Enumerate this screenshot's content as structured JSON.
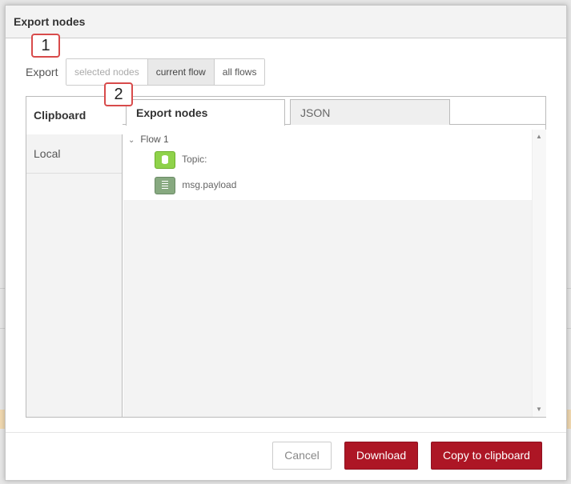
{
  "dialog": {
    "title": "Export nodes"
  },
  "export": {
    "label": "Export",
    "options": [
      "selected nodes",
      "current flow",
      "all flows"
    ],
    "selected": "current flow"
  },
  "callouts": [
    "1",
    "2"
  ],
  "left_tabs": [
    {
      "label": "Clipboard",
      "active": true
    },
    {
      "label": "Local",
      "active": false
    }
  ],
  "top_tabs": [
    {
      "label": "Export nodes",
      "active": true
    },
    {
      "label": "JSON",
      "active": false
    }
  ],
  "tree": {
    "flow": "Flow 1",
    "nodes": [
      {
        "label": "Topic:",
        "icon": "database-icon",
        "color": "#8fd24a"
      },
      {
        "label": "msg.payload",
        "icon": "debug-list-icon",
        "color": "#87a980"
      }
    ]
  },
  "footer": {
    "cancel": "Cancel",
    "download": "Download",
    "copy": "Copy to clipboard"
  },
  "colors": {
    "primary": "#ad1625",
    "callout_border": "#d84b4b"
  }
}
